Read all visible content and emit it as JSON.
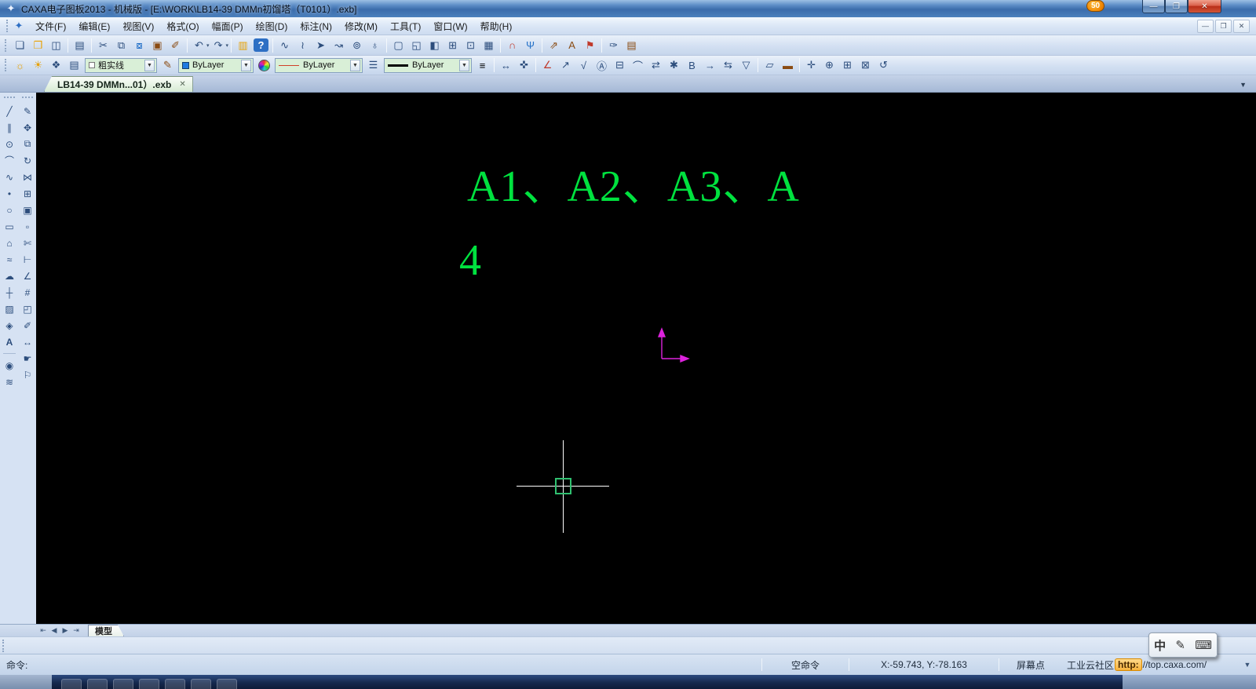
{
  "window": {
    "title": "CAXA电子图板2013 - 机械版 - [E:\\WORK\\LB14-39 DMMn初馏塔（T0101）.exb]",
    "overlay_badge": "50",
    "controls": {
      "minimize": "—",
      "maximize": "❐",
      "close": "✕"
    }
  },
  "menu": {
    "items": [
      "文件(F)",
      "编辑(E)",
      "视图(V)",
      "格式(O)",
      "幅面(P)",
      "绘图(D)",
      "标注(N)",
      "修改(M)",
      "工具(T)",
      "窗口(W)",
      "帮助(H)"
    ],
    "mdi": {
      "minimize": "—",
      "restore": "❐",
      "close": "✕"
    }
  },
  "toolbar1": {
    "icons": [
      {
        "n": "new-file-icon",
        "g": "❏"
      },
      {
        "n": "open-file-icon",
        "g": "❒"
      },
      {
        "n": "save-icon",
        "g": "◫"
      },
      {
        "n": "print-icon",
        "g": "▤"
      },
      {
        "n": "cut-icon",
        "g": "✂"
      },
      {
        "n": "copy-icon",
        "g": "⧉"
      },
      {
        "n": "copy-basepoint-icon",
        "g": "⧇"
      },
      {
        "n": "paste-icon",
        "g": "▣"
      },
      {
        "n": "paste-special-icon",
        "g": "✐"
      },
      {
        "n": "undo-icon",
        "g": "↶"
      },
      {
        "n": "redo-icon",
        "g": "↷"
      },
      {
        "n": "ole-object-icon",
        "g": "▥"
      },
      {
        "n": "help-icon",
        "g": "?"
      },
      {
        "n": "spline-icon",
        "g": "∿"
      },
      {
        "n": "sketch-icon",
        "g": "≀"
      },
      {
        "n": "arrow-icon",
        "g": "➤"
      },
      {
        "n": "freehand-icon",
        "g": "↝"
      },
      {
        "n": "part-enlarge-icon",
        "g": "⊚"
      },
      {
        "n": "roll-curve-icon",
        "g": "♁"
      },
      {
        "n": "frame-icon",
        "g": "▢"
      },
      {
        "n": "frame-settings-icon",
        "g": "◱"
      },
      {
        "n": "title-block-icon",
        "g": "◧"
      },
      {
        "n": "table-icon",
        "g": "⊞"
      },
      {
        "n": "serial-number-icon",
        "g": "⊡"
      },
      {
        "n": "bom-table-icon",
        "g": "▦"
      },
      {
        "n": "magnet-icon",
        "g": "∩"
      },
      {
        "n": "merge-icon",
        "g": "Ψ"
      },
      {
        "n": "dimension-drive-icon",
        "g": "⇗"
      },
      {
        "n": "font-style-icon",
        "g": "A"
      },
      {
        "n": "flag-icon",
        "g": "⚑"
      },
      {
        "n": "pin-icon",
        "g": "✑"
      },
      {
        "n": "note-icon",
        "g": "▤"
      }
    ],
    "dropdown_glyph": "▾"
  },
  "toolbar2": {
    "combos": {
      "layer": "粗实线",
      "color": "ByLayer",
      "linetype": "ByLayer",
      "lineweight": "ByLayer"
    },
    "icons": [
      {
        "n": "layer-on-icon",
        "g": "☼"
      },
      {
        "n": "layer-bright-icon",
        "g": "☀"
      },
      {
        "n": "layer-key-icon",
        "g": "❖"
      },
      {
        "n": "layer-print-icon",
        "g": "▤"
      },
      {
        "n": "layer-settings-icon",
        "g": "✎"
      },
      {
        "n": "linetype-manager-icon",
        "g": "☰"
      },
      {
        "n": "lineweight-manager-icon",
        "g": "≡"
      },
      {
        "n": "linear-dimension-icon",
        "g": "↔"
      },
      {
        "n": "smart-dimension-icon",
        "g": "✜"
      },
      {
        "n": "angle-dimension-icon",
        "g": "∠"
      },
      {
        "n": "leader-icon",
        "g": "↗"
      },
      {
        "n": "datum-icon",
        "g": "√"
      },
      {
        "n": "text-frame-icon",
        "g": "Ⓐ"
      },
      {
        "n": "tolerance-icon",
        "g": "⊟"
      },
      {
        "n": "curve-dimension-icon",
        "g": "⌒"
      },
      {
        "n": "align-dimension-icon",
        "g": "⇄"
      },
      {
        "n": "style-gear-icon",
        "g": "✱"
      },
      {
        "n": "char-style-icon",
        "g": "B"
      },
      {
        "n": "move-text-icon",
        "g": "→"
      },
      {
        "n": "align-text-icon",
        "g": "⇆"
      },
      {
        "n": "datum-target-icon",
        "g": "▽"
      },
      {
        "n": "new-view-icon",
        "g": "▱"
      },
      {
        "n": "measure-icon",
        "g": "▬"
      },
      {
        "n": "dynamic-pan-icon",
        "g": "✛"
      },
      {
        "n": "zoom-in-icon",
        "g": "⊕"
      },
      {
        "n": "zoom-window-icon",
        "g": "⊞"
      },
      {
        "n": "zoom-all-icon",
        "g": "⊠"
      },
      {
        "n": "zoom-back-icon",
        "g": "↺"
      }
    ]
  },
  "tabs": {
    "document": "LB14-39 DMMn...01）.exb",
    "close": "✕",
    "list_dropdown": "▼"
  },
  "palette": {
    "draw": [
      {
        "n": "line-tool-icon",
        "g": "╱"
      },
      {
        "n": "parallel-line-tool-icon",
        "g": "∥"
      },
      {
        "n": "circle-tool-icon",
        "g": "⊙"
      },
      {
        "n": "arc-tool-icon",
        "g": "⌒"
      },
      {
        "n": "spline-tool-icon",
        "g": "∿"
      },
      {
        "n": "point-tool-icon",
        "g": "•"
      },
      {
        "n": "ellipse-tool-icon",
        "g": "○"
      },
      {
        "n": "rectangle-tool-icon",
        "g": "▭"
      },
      {
        "n": "polygon-tool-icon",
        "g": "⌂"
      },
      {
        "n": "wave-line-tool-icon",
        "g": "≈"
      },
      {
        "n": "cloud-line-tool-icon",
        "g": "☁"
      },
      {
        "n": "center-line-tool-icon",
        "g": "┼"
      },
      {
        "n": "hatch-tool-icon",
        "g": "▨"
      },
      {
        "n": "leader-label-tool-icon",
        "g": "◈"
      },
      {
        "n": "text-tool-icon",
        "g": "A"
      },
      {
        "n": "local-enlarge-tool-icon",
        "g": "◉"
      },
      {
        "n": "section-line-tool-icon",
        "g": "≋"
      }
    ],
    "modify": [
      {
        "n": "properties-edit-icon",
        "g": "✎"
      },
      {
        "n": "move-tool-icon",
        "g": "✥"
      },
      {
        "n": "copy-tool-icon",
        "g": "⧉"
      },
      {
        "n": "rotate-tool-icon",
        "g": "↻"
      },
      {
        "n": "mirror-tool-icon",
        "g": "⋈"
      },
      {
        "n": "array-tool-icon",
        "g": "⊞"
      },
      {
        "n": "scale-tool-icon",
        "g": "▣"
      },
      {
        "n": "stretch-tool-icon",
        "g": "▫"
      },
      {
        "n": "trim-tool-icon",
        "g": "✄"
      },
      {
        "n": "extend-tool-icon",
        "g": "⊢"
      },
      {
        "n": "chamfer-tool-icon",
        "g": "∠"
      },
      {
        "n": "crop-tool-icon",
        "g": "#"
      },
      {
        "n": "view-rotate-tool-icon",
        "g": "◰"
      },
      {
        "n": "dimension-edit-icon",
        "g": "✐"
      },
      {
        "n": "dimension-spacing-icon",
        "g": "↔"
      },
      {
        "n": "click-select-icon",
        "g": "☛"
      },
      {
        "n": "tag-edit-icon",
        "g": "⚐"
      }
    ]
  },
  "canvas": {
    "text_line1": "A1、A2、A3、A",
    "text_line2": "4"
  },
  "sheet_tabs": {
    "nav": [
      "⇤",
      "◀",
      "▶",
      "⇥"
    ],
    "model": "模型"
  },
  "status": {
    "command_label": "命令:",
    "mode": "空命令",
    "coords": "X:-59.743, Y:-78.163",
    "pick_mode": "屏幕点",
    "cloud_label": "工业云社区",
    "url_prefix": "http:",
    "url_rest": "//top.caxa.com/",
    "options_dropdown": "▼"
  },
  "ime": {
    "mode": "中",
    "pen": "✎",
    "keyboard": "⌨"
  },
  "colors": {
    "cad_text_green": "#00e23f",
    "ucs_axis_magenta": "#dd22dd",
    "pickbox_green": "#30c070",
    "title_bar_blue": "#3b6cab",
    "combo_background_green": "#d9efd7",
    "badge_orange": "#ef8400",
    "taskbar_navy": "#16294e",
    "canvas_black": "#000000"
  }
}
